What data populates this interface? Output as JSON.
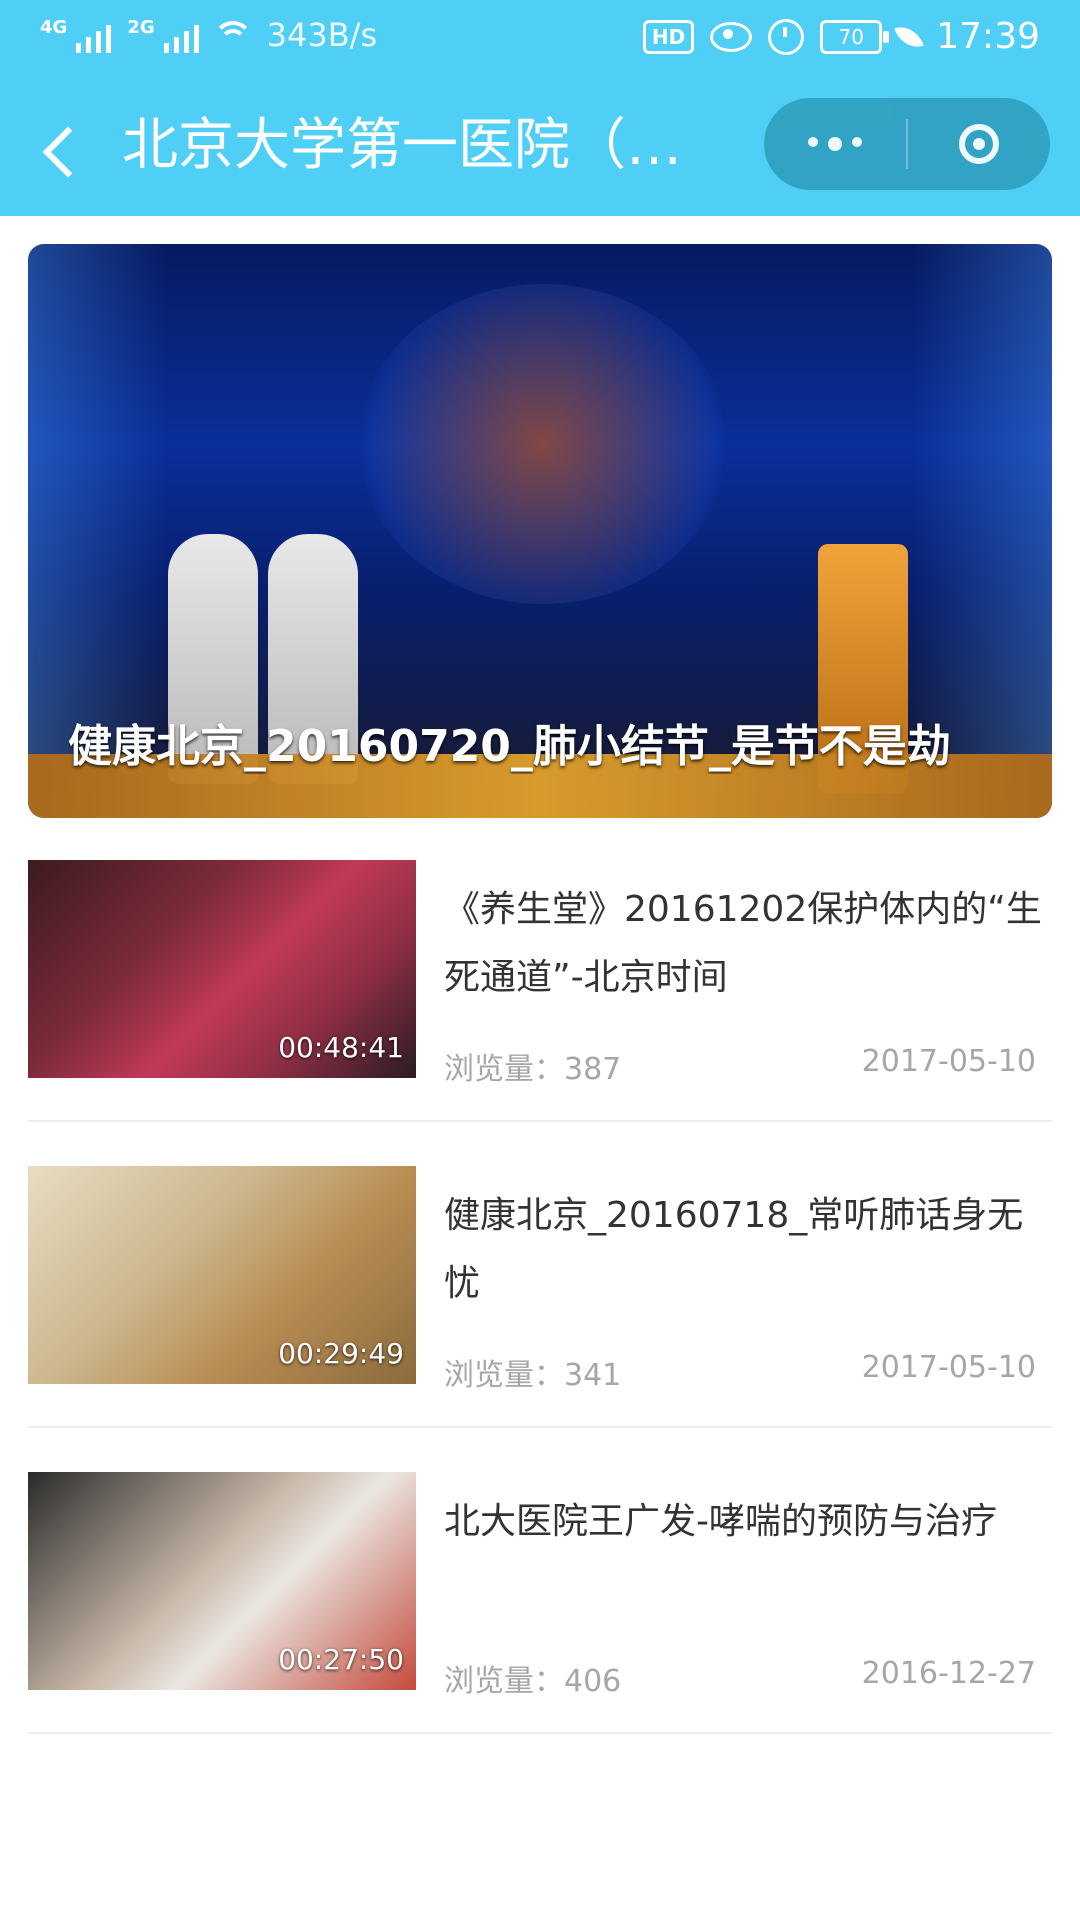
{
  "status_bar": {
    "signal_1": "4G",
    "signal_2": "2G",
    "speed": "343B/s",
    "hd": "HD",
    "battery": "70",
    "time": "17:39"
  },
  "nav": {
    "title": "北京大学第一医院（…"
  },
  "hero": {
    "caption": "健康北京_20160720_肺小结节_是节不是劫"
  },
  "videos": [
    {
      "title": "《养生堂》20161202保护体内的“生死通道”-北京时间",
      "duration": "00:48:41",
      "views": "浏览量：387",
      "date": "2017-05-10"
    },
    {
      "title": "健康北京_20160718_常听肺话身无忧",
      "duration": "00:29:49",
      "views": "浏览量：341",
      "date": "2017-05-10"
    },
    {
      "title": "北大医院王广发-哮喘的预防与治疗",
      "duration": "00:27:50",
      "views": "浏览量：406",
      "date": "2016-12-27"
    }
  ],
  "colors": {
    "header": "#4fcff6",
    "title_text": "#333333",
    "meta_text": "#a6a6a6"
  },
  "icons": [
    "signal-icon",
    "wifi-icon",
    "hd-icon",
    "eye-icon",
    "alarm-icon",
    "battery-icon",
    "leaf-icon",
    "back-icon",
    "more-icon",
    "record-icon"
  ]
}
